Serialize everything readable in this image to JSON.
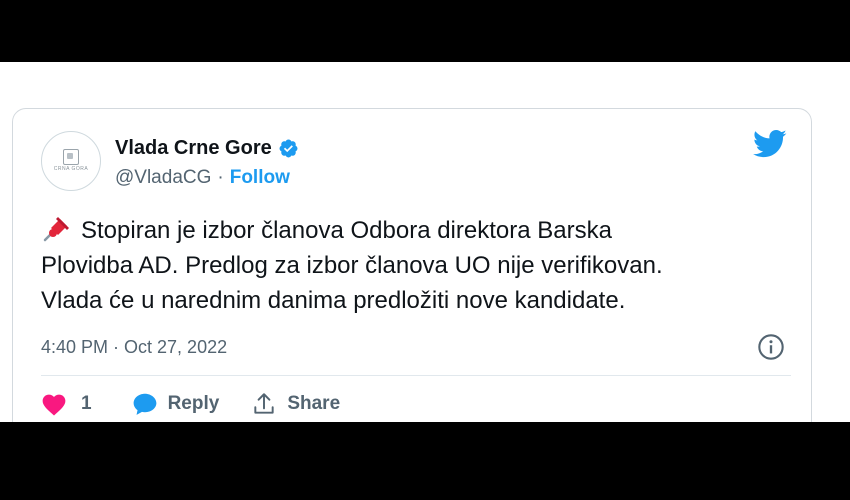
{
  "tweet": {
    "author_name": "Vlada Crne Gore",
    "handle": "@VladaCG",
    "separator": "·",
    "follow_label": "Follow",
    "avatar_text": "CRNA GORA",
    "body_lines": [
      "Stopiran je izbor članova Odbora direktora Barska",
      "Plovidba AD. Predlog za izbor članova UO nije verifikovan.",
      "Vlada će u narednim danima predložiti nove kandidate."
    ],
    "timestamp": "4:40 PM · Oct 27, 2022",
    "like_count": "1",
    "reply_label": "Reply",
    "share_label": "Share"
  },
  "icons": {
    "avatar": "government-logo-icon",
    "verified": "verified-badge-icon",
    "bird": "twitter-bird-icon",
    "pin": "pushpin-icon",
    "info": "info-icon",
    "like": "heart-icon",
    "reply": "speech-bubble-icon",
    "share": "share-icon"
  },
  "colors": {
    "accent": "#1d9bf0",
    "text": "#0f1419",
    "muted": "#536471",
    "like": "#f91880",
    "border": "#d3d9de"
  }
}
